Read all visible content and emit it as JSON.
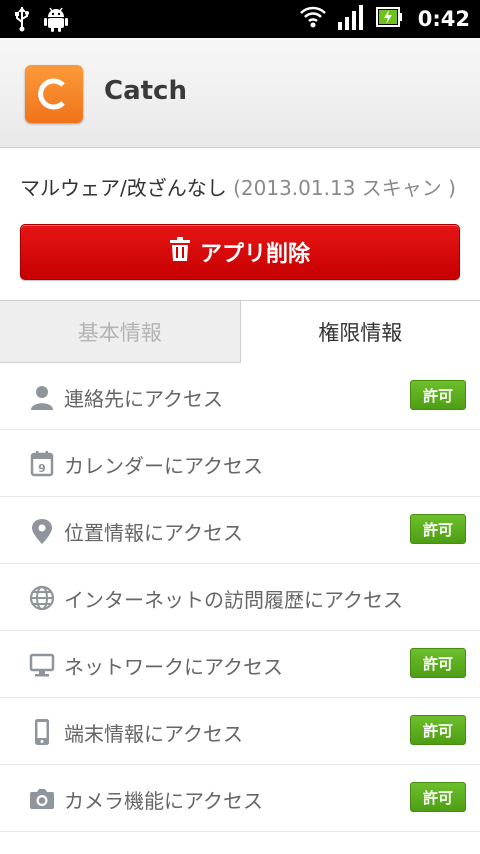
{
  "status_bar": {
    "time": "0:42",
    "icons": [
      "usb-icon",
      "android-icon",
      "wifi-icon",
      "signal-icon",
      "battery-charging-icon"
    ]
  },
  "app": {
    "name": "Catch",
    "icon_letter": "C",
    "icon_color": "#f7831f"
  },
  "scan": {
    "status": "マルウェア/改ざんなし",
    "date": " (2013.01.13 スキャン )"
  },
  "delete_button": {
    "label": "アプリ削除",
    "icon": "trash-icon",
    "color": "#d60000"
  },
  "tabs": [
    {
      "label": "基本情報",
      "active": false
    },
    {
      "label": "権限情報",
      "active": true
    }
  ],
  "permissions": [
    {
      "icon": "person-icon",
      "label": "連絡先にアクセス",
      "badge": "許可"
    },
    {
      "icon": "calendar-icon",
      "label": "カレンダーにアクセス",
      "badge": ""
    },
    {
      "icon": "location-pin-icon",
      "label": "位置情報にアクセス",
      "badge": "許可"
    },
    {
      "icon": "globe-icon",
      "label": "インターネットの訪問履歴にアクセス",
      "badge": ""
    },
    {
      "icon": "monitor-icon",
      "label": "ネットワークにアクセス",
      "badge": "許可"
    },
    {
      "icon": "phone-device-icon",
      "label": "端末情報にアクセス",
      "badge": "許可"
    },
    {
      "icon": "camera-icon",
      "label": "カメラ機能にアクセス",
      "badge": "許可"
    }
  ],
  "colors": {
    "badge_green": "#5cad1f",
    "icon_gray": "#8f959c"
  }
}
